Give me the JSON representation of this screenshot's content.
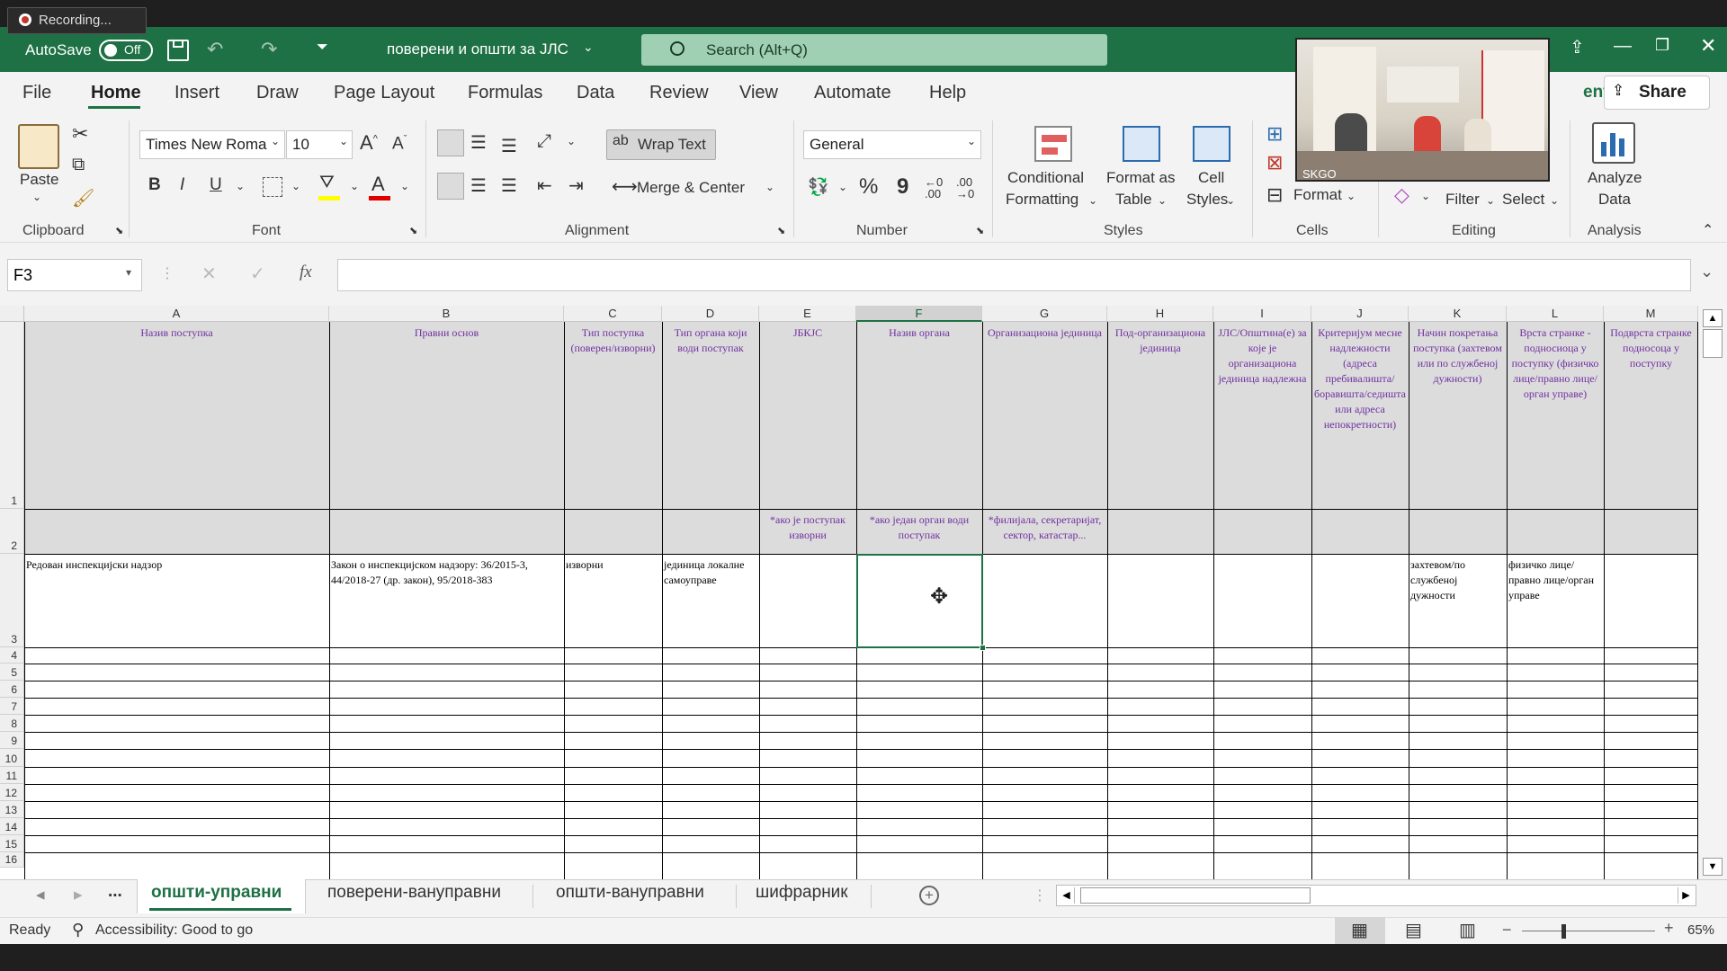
{
  "recording": {
    "label": "Recording..."
  },
  "titlebar": {
    "autosave_label": "AutoSave",
    "autosave_state": "Off",
    "document_title": "поверени и општи за ЈЛС",
    "search_placeholder": "Search (Alt+Q)",
    "share_label": "Share",
    "comments_label": "ents"
  },
  "menu": [
    "File",
    "Home",
    "Insert",
    "Draw",
    "Page Layout",
    "Formulas",
    "Data",
    "Review",
    "View",
    "Automate",
    "Help"
  ],
  "ribbon": {
    "clipboard": {
      "group": "Clipboard",
      "paste": "Paste"
    },
    "font": {
      "group": "Font",
      "name": "Times New Roma",
      "size": "10",
      "bold": "B",
      "italic": "I",
      "underline": "U"
    },
    "alignment": {
      "group": "Alignment",
      "wrap": "Wrap Text",
      "merge": "Merge & Center"
    },
    "number": {
      "group": "Number",
      "format": "General",
      "percent": "%",
      "comma": "9"
    },
    "styles": {
      "group": "Styles",
      "conditional_1": "Conditional",
      "conditional_2": "Formatting",
      "format_as_1": "Format as",
      "format_as_2": "Table",
      "cell_styles_1": "Cell",
      "cell_styles_2": "Styles"
    },
    "cells": {
      "group": "Cells",
      "format": "Format"
    },
    "editing": {
      "group": "Editing",
      "filter": "Filter",
      "select": "Select"
    },
    "analysis": {
      "group": "Analysis",
      "analyze_1": "Analyze",
      "analyze_2": "Data"
    }
  },
  "formula_bar": {
    "name_box": "F3",
    "fx": "fx",
    "content": ""
  },
  "columns": [
    "A",
    "B",
    "C",
    "D",
    "E",
    "F",
    "G",
    "H",
    "I",
    "J",
    "K",
    "L",
    "M"
  ],
  "rows_visible": [
    "1",
    "2",
    "3",
    "4",
    "5",
    "6",
    "7",
    "8",
    "9",
    "10",
    "11",
    "12",
    "13",
    "14",
    "15",
    "16"
  ],
  "headers_row1": [
    "Назив поступка",
    "Правни основ",
    "Тип поступка (поверен/изворни)",
    "Тип органа који води поступак",
    "ЈБКЈС",
    "Назив органа",
    "Организациона јединица",
    "Под-организациона јединица",
    "ЈЛС/Општина(е) за које је организациона јединица надлежна",
    "Критеријум месне надлежности (адреса пребивалишта/боравишта/седишта или адреса непокретности)",
    "Начин покретања поступка (захтевом или по службеној дужности)",
    "Врста странке - подносиоца у поступку (физичко лице/правно лице/орган управе)",
    "Подврста странке подносоца у поступку"
  ],
  "notes_row2": {
    "E": "*ако је поступак изворни",
    "F": "*ако један орган води поступак",
    "G": "*филијала, секретаријат, сектор, катастар..."
  },
  "data_row3": {
    "A": "Редован инспекцијски надзор",
    "B": "Закон о инспекцијском надзору: 36/2015-3, 44/2018-27 (др. закон), 95/2018-383",
    "C": "изворни",
    "D": "јединица локалне самоуправе",
    "K": "захтевом/по службеној дужности",
    "L": "физичко лице/правно лице/орган управе"
  },
  "sheets": [
    "општи-управни",
    "поверени-вануправни",
    "општи-вануправни",
    "шифрарник"
  ],
  "active_sheet": 0,
  "status": {
    "ready": "Ready",
    "accessibility": "Accessibility: Good to go",
    "zoom": "65%"
  },
  "video": {
    "label": "SKGO"
  }
}
